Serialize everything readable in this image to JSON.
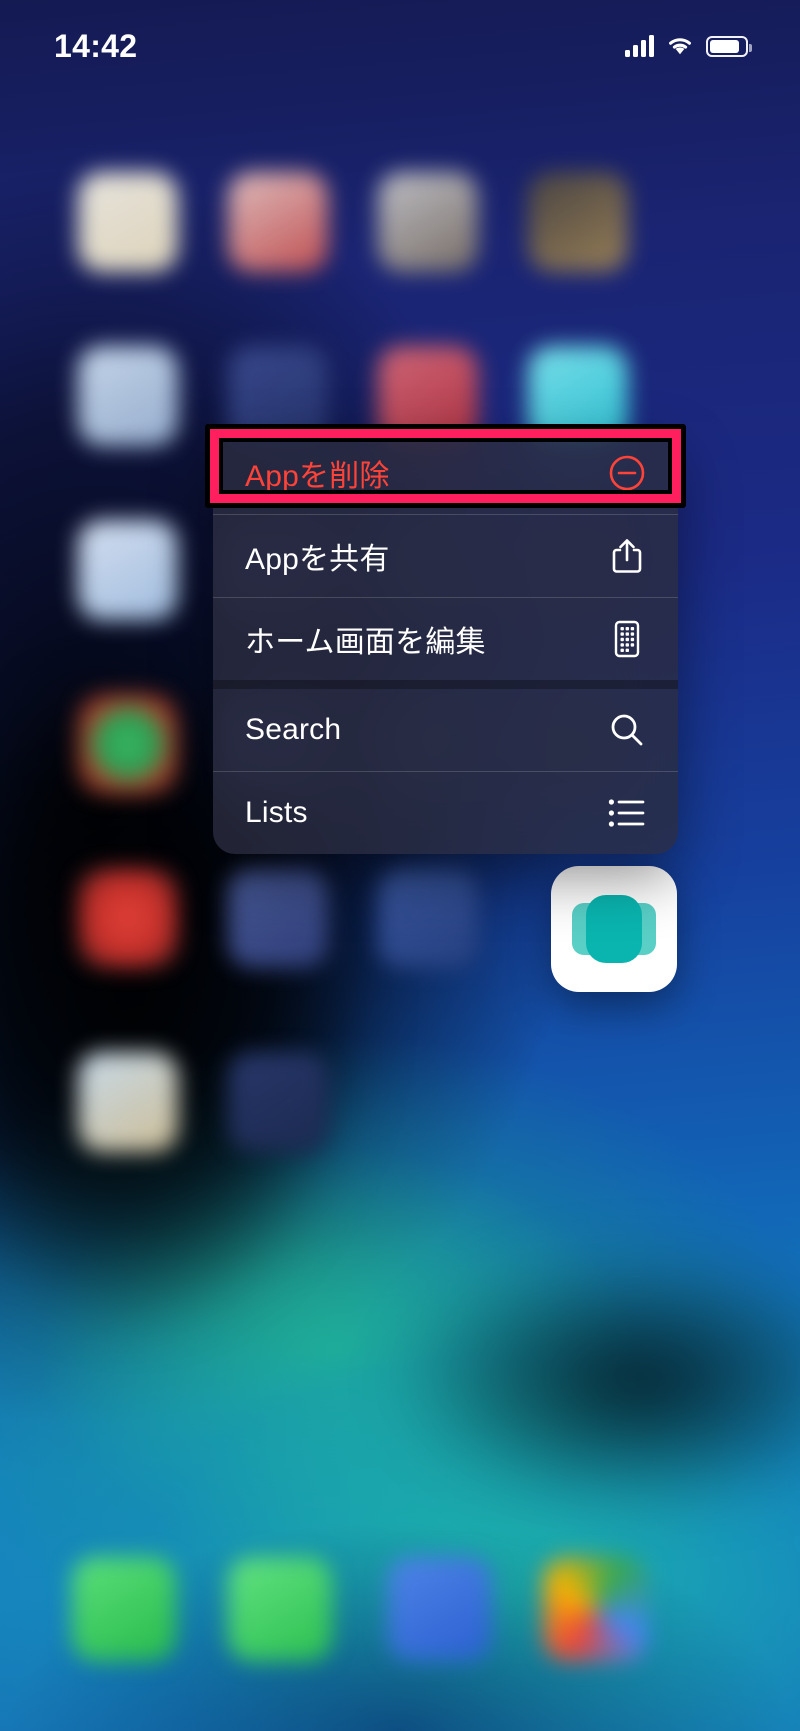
{
  "device": "iphone-home-screen",
  "status_bar": {
    "time": "14:42",
    "cellular_icon": "signal-bars-icon",
    "wifi_icon": "wifi-icon",
    "battery_icon": "battery-icon"
  },
  "context_menu": {
    "items": [
      {
        "label": "Appを削除",
        "icon": "minus-circle-icon",
        "style": "destructive",
        "highlighted": true
      },
      {
        "label": "Appを共有",
        "icon": "share-icon",
        "style": "default",
        "highlighted": false
      },
      {
        "label": "ホーム画面を編集",
        "icon": "edit-home-screen-icon",
        "style": "default",
        "highlighted": false
      },
      {
        "label": "Search",
        "icon": "search-icon",
        "style": "default",
        "highlighted": false
      },
      {
        "label": "Lists",
        "icon": "bullet-list-icon",
        "style": "default",
        "highlighted": false
      }
    ]
  },
  "focused_app": {
    "icon": "app-icon-teal-rounded",
    "background": "#ffffff",
    "accent": "#0ab5b0"
  },
  "colors": {
    "highlight_border": "#ff1f5f",
    "highlight_outline": "#000000",
    "destructive_text": "#ff4338",
    "menu_background": "rgba(42,44,63,0.80)",
    "menu_text": "#ffffff",
    "status_text": "#ffffff"
  }
}
